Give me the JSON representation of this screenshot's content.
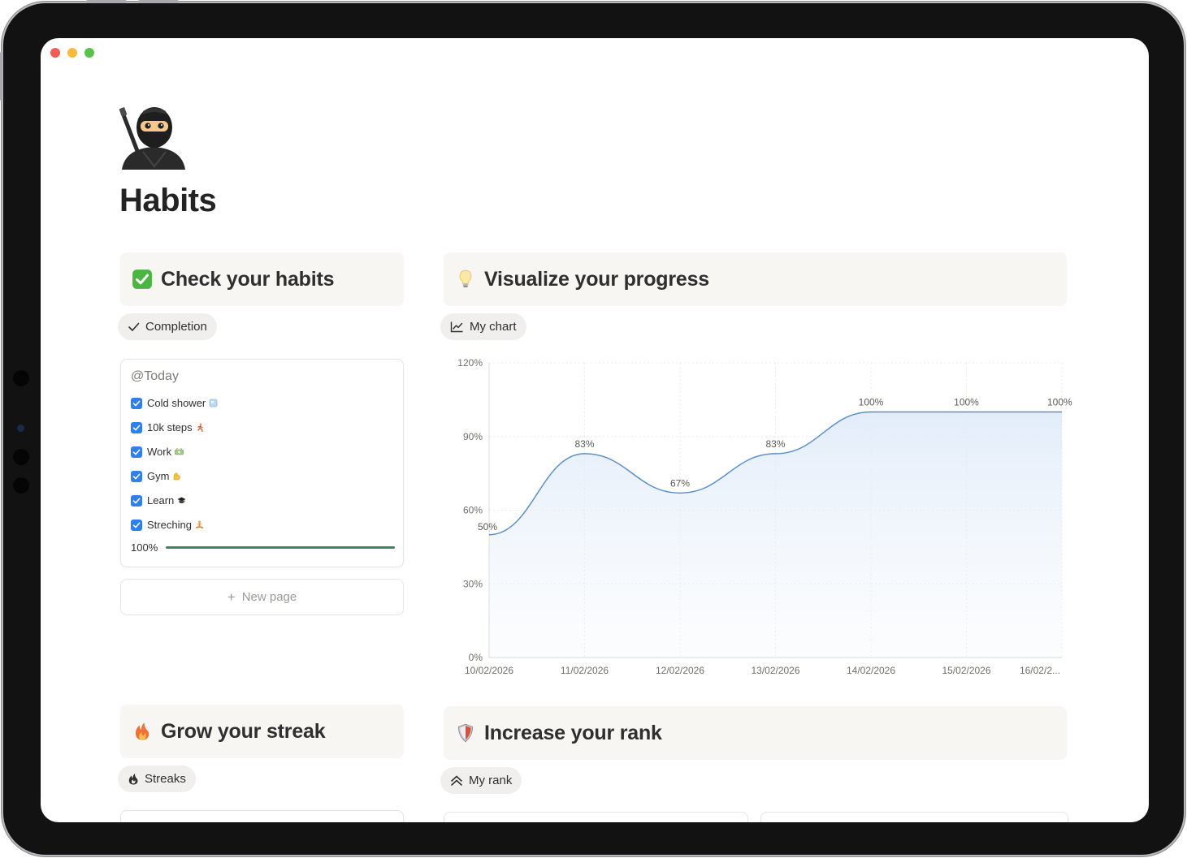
{
  "page": {
    "title": "Habits"
  },
  "sections": {
    "habits": {
      "title": "Check your habits",
      "view_label": "Completion",
      "card": {
        "date_label": "@Today",
        "items": [
          {
            "label": "Cold shower",
            "checked": true,
            "emoji": "ice-icon"
          },
          {
            "label": "10k steps",
            "checked": true,
            "emoji": "runner-icon"
          },
          {
            "label": "Work",
            "checked": true,
            "emoji": "money-icon"
          },
          {
            "label": "Gym",
            "checked": true,
            "emoji": "muscle-icon"
          },
          {
            "label": "Learn",
            "checked": true,
            "emoji": "graduation-cap-icon"
          },
          {
            "label": "Streching",
            "checked": true,
            "emoji": "yoga-icon"
          }
        ],
        "progress_label": "100%",
        "progress_value": 1.0
      },
      "new_page_label": "New page"
    },
    "progress": {
      "title": "Visualize your progress",
      "view_label": "My chart"
    },
    "streak": {
      "title": "Grow your streak",
      "view_label": "Streaks"
    },
    "rank": {
      "title": "Increase your rank",
      "view_label": "My rank"
    }
  },
  "colors": {
    "accent_blue": "#2f80ed",
    "progress_green": "#448361",
    "chart_line": "#5b8fc9",
    "header_bg": "#f7f6f3"
  },
  "chart_data": {
    "type": "area",
    "x": [
      "10/02/2026",
      "11/02/2026",
      "12/02/2026",
      "13/02/2026",
      "14/02/2026",
      "15/02/2026",
      "16/02/2..."
    ],
    "series": [
      {
        "values": [
          50,
          83,
          67,
          83,
          100,
          100,
          100
        ],
        "labels": [
          "50%",
          "83%",
          "67%",
          "83%",
          "100%",
          "100%",
          "100%"
        ]
      }
    ],
    "y_ticks": [
      "0%",
      "30%",
      "60%",
      "90%",
      "120%"
    ],
    "ylim": [
      0,
      120
    ],
    "grid": true,
    "legend": "none"
  }
}
